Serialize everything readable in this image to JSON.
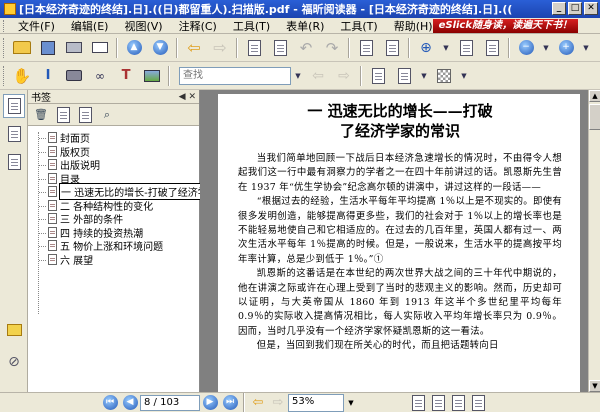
{
  "window": {
    "title": "[日本经济奇迹的终结].日].((日)都留重人).扫描版.pdf - 福昕阅读器 - [日本经济奇迹的终结].日].(("
  },
  "menu": {
    "items": [
      "文件(F)",
      "编辑(E)",
      "视图(V)",
      "注释(C)",
      "工具(T)",
      "表单(R)",
      "工具(T)",
      "帮助(H)"
    ],
    "banner": "eSlick随身读，读遍天下书！"
  },
  "toolbar": {
    "find_placeholder": "查找"
  },
  "bookmarks": {
    "panel_title": "书签",
    "items": [
      "封面页",
      "版权页",
      "出版说明",
      "目录",
      "一 迅速无比的增长-打破了经济学家的常识",
      "二 各种结构性的变化",
      "三 外部的条件",
      "四 持续的投资热潮",
      "五 物价上涨和环境问题",
      "六 展望"
    ]
  },
  "document": {
    "chapter_title": "一   迅速无比的增长——打破",
    "chapter_subtitle": "了经济学家的常识",
    "paragraphs": [
      "当我们简单地回顾一下战后日本经济急速增长的情况时，不由得令人想起我们这一行中最有洞察力的学者之一在四十年前讲过的话。凯恩斯先生曾在 1937 年“优生学协会”纪念高尔顿的讲演中，讲过这样的一段话——",
      "“根据过去的经验，生活水平每年平均提高 1％以上是不现实的。即使有很多发明创造，能够提高得更多些，我们的社会对于 1％以上的增长率也是不能轻易地使自己和它相适应的。在过去的几百年里，英国人都有过一、两次生活水平每年 1％提高的时候。但是，一般说来，生活水平的提高按平均年率计算，总是少到低于 1％。”①",
      "凯恩斯的这番话是在本世纪的两次世界大战之间的三十年代中期说的，他在讲演之际或许在心理上受到了当时的悲观主义的影响。然而，历史却可以证明，与大英帝国从 1860 年到 1913 年这半个多世纪里平均每年 0.9％的实际收入提高情况相比，每人实际收入平均年增长率只为 0.9％。因而，当时几乎没有一个经济学家怀疑凯恩斯的这一看法。",
      "但是，当回到我们现在所关心的时代，而且把话题转向日"
    ]
  },
  "status": {
    "page_display": "8 / 103",
    "zoom": "53%"
  }
}
